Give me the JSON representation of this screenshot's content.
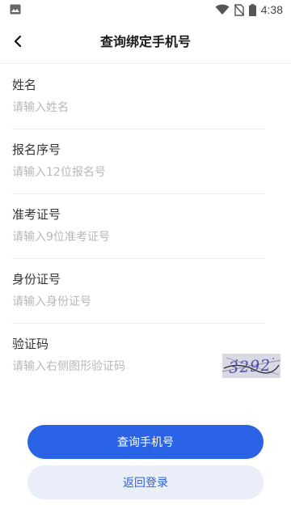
{
  "status_bar": {
    "time": "4:38",
    "icons": [
      "image-icon",
      "wifi-icon",
      "no-sim-icon",
      "battery-icon"
    ]
  },
  "header": {
    "title": "查询绑定手机号",
    "back_icon": "chevron-left-icon"
  },
  "form": {
    "fields": [
      {
        "label": "姓名",
        "placeholder": "请输入姓名",
        "value": ""
      },
      {
        "label": "报名序号",
        "placeholder": "请输入12位报名号",
        "value": ""
      },
      {
        "label": "准考证号",
        "placeholder": "请输入9位准考证号",
        "value": ""
      },
      {
        "label": "身份证号",
        "placeholder": "请输入身份证号",
        "value": ""
      },
      {
        "label": "验证码",
        "placeholder": "请输入右侧图形验证码",
        "value": ""
      }
    ],
    "captcha_text": "3292"
  },
  "actions": {
    "primary_label": "查询手机号",
    "secondary_label": "返回登录"
  },
  "colors": {
    "accent": "#2a63e6",
    "secondary_bg": "#eaeef9",
    "placeholder": "#b8b8b8"
  }
}
